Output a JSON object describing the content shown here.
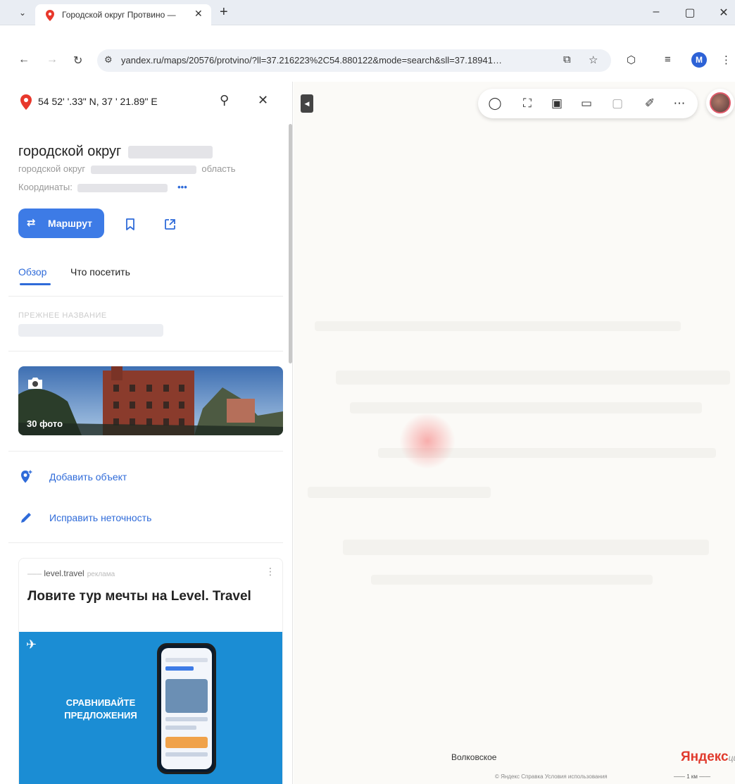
{
  "browser": {
    "tab_title": "Городской округ Протвино —",
    "url": "yandex.ru/maps/20576/protvino/?ll=37.216223%2C54.880122&mode=search&sll=37.18941…",
    "profile_initial": "M"
  },
  "sidebar": {
    "coordinates_query": "54 52'  '.33\" N, 37  ' 21.89\" E",
    "title": "городской округ",
    "subtitle_prefix": "городской округ",
    "subtitle_suffix": "область",
    "coords_label": "Координаты:",
    "coords_more": "•••",
    "route_label": "Маршрут",
    "tabs": [
      {
        "label": "Обзор",
        "active": true
      },
      {
        "label": "Что посетить",
        "active": false
      }
    ],
    "former_name_label": "ПРЕЖНЕЕ НАЗВАНИЕ",
    "photo_count": "30 фото",
    "actions": [
      {
        "label": "Добавить объект",
        "icon": "add-location-icon"
      },
      {
        "label": "Исправить неточность",
        "icon": "pencil-icon"
      }
    ],
    "ad": {
      "source": "level.travel",
      "badge": "реклама",
      "headline": "Ловите тур мечты на Level. Travel",
      "promo": "СРАВНИВАЙТЕ ПРЕДЛОЖЕНИЯ",
      "slide_progress": 0.35
    }
  },
  "map": {
    "place_label": "Волковское",
    "logo": "Яндекс",
    "logo_tail": "ций",
    "credits": "© Яндекс  Справка  Условия использования",
    "scale": "1 км"
  },
  "colors": {
    "accent": "#3d7be6",
    "pin_red": "#e8382c",
    "ad_blue": "#1b8dd4"
  }
}
